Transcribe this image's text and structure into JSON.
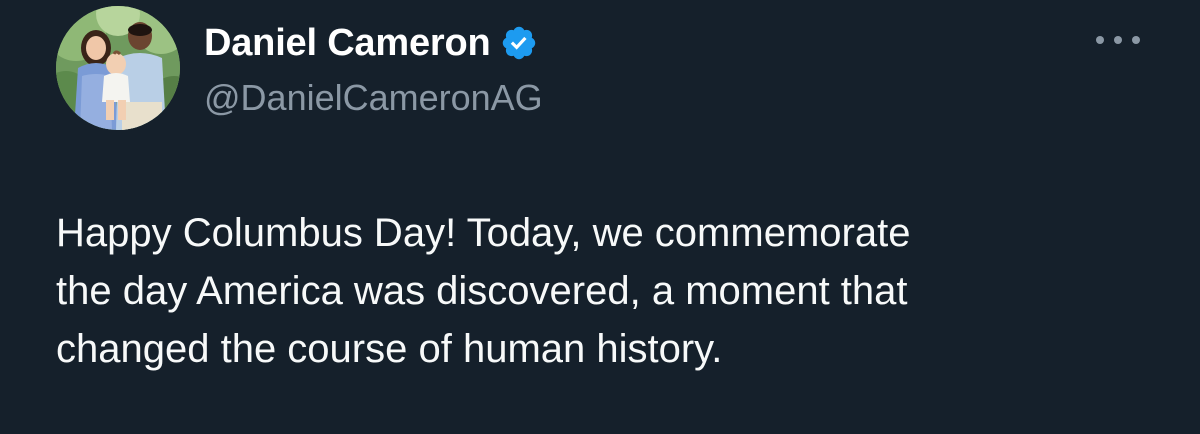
{
  "author": {
    "display_name": "Daniel Cameron",
    "handle": "@DanielCameronAG",
    "verified": true
  },
  "icons": {
    "verified": "verified-badge-icon",
    "more": "more-options-icon"
  },
  "tweet": {
    "text": "Happy Columbus Day! Today, we commemorate\nthe day America was discovered, a moment that\nchanged the course of human history."
  },
  "colors": {
    "background": "#15202b",
    "verified_badge": "#1d9bf0",
    "secondary_text": "#8b98a5"
  }
}
